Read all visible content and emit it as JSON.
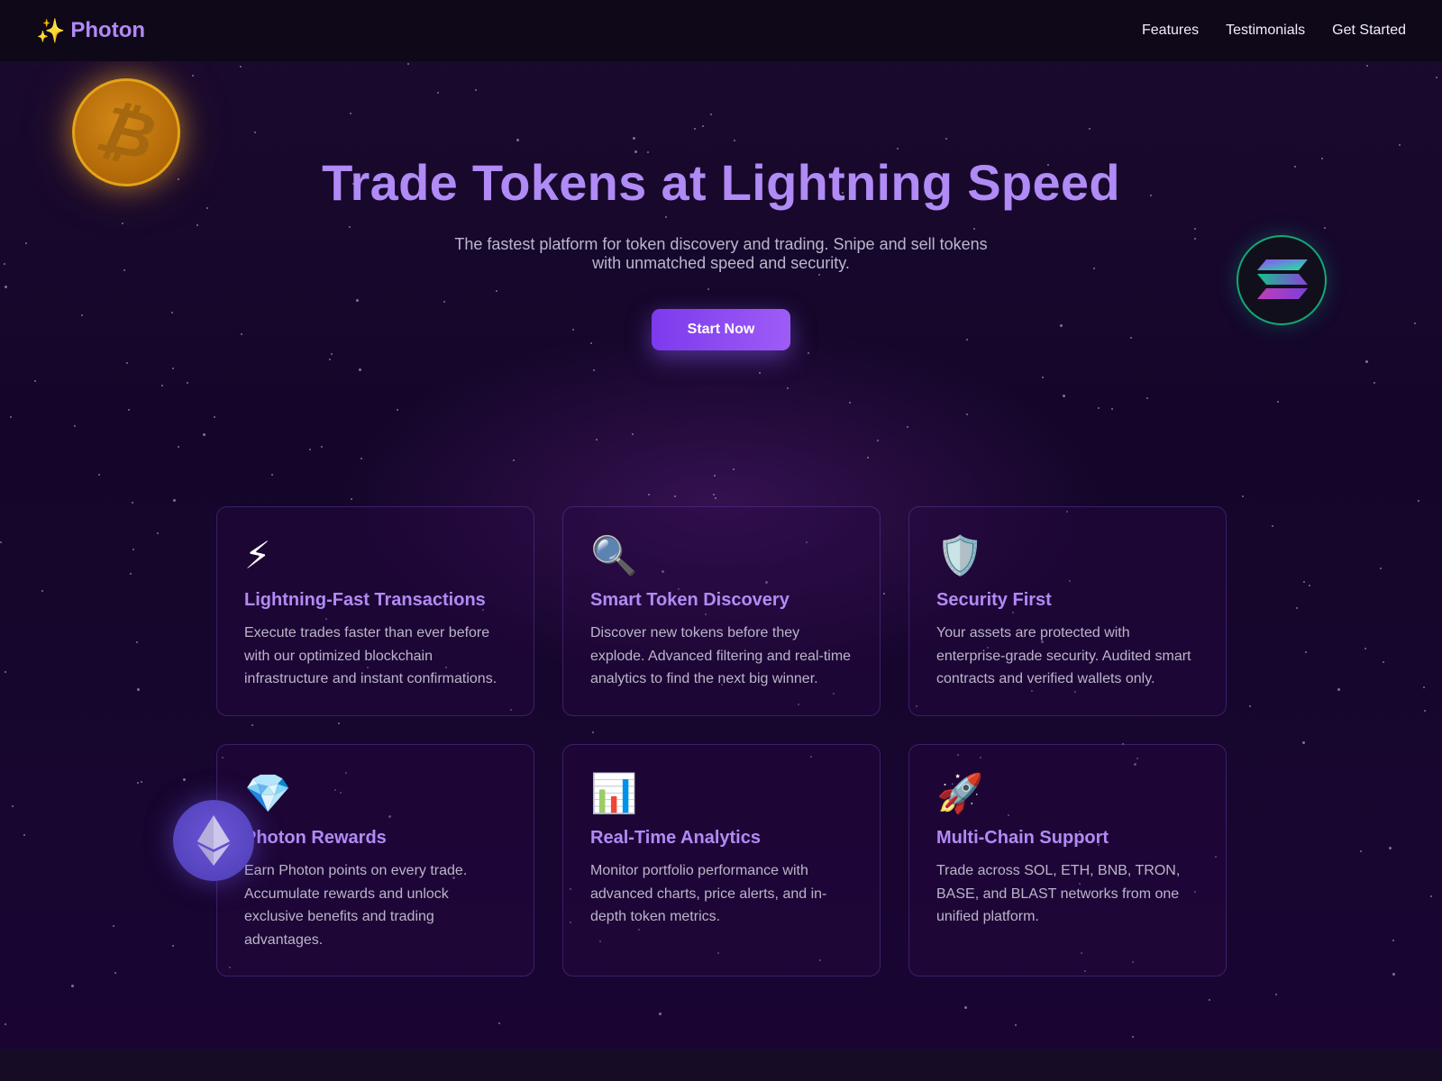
{
  "nav": {
    "logo_icon": "✨",
    "logo_text": "Photon",
    "links": [
      "Features",
      "Testimonials",
      "Get Started"
    ]
  },
  "hero": {
    "title": "Trade Tokens at Lightning Speed",
    "subtitle": "The fastest platform for token discovery and trading. Snipe and sell tokens with unmatched speed and security.",
    "cta_label": "Start Now"
  },
  "coins": {
    "btc_glyph": "₿",
    "btc_icon": "bitcoin-icon",
    "sol_icon": "solana-icon",
    "eth_icon": "ethereum-icon"
  },
  "features": [
    {
      "icon": "⚡",
      "icon_name": "lightning-icon",
      "title": "Lightning-Fast Transactions",
      "desc": "Execute trades faster than ever before with our optimized blockchain infrastructure and instant confirmations."
    },
    {
      "icon": "🔍",
      "icon_name": "magnifier-icon",
      "title": "Smart Token Discovery",
      "desc": "Discover new tokens before they explode. Advanced filtering and real-time analytics to find the next big winner."
    },
    {
      "icon": "🛡️",
      "icon_name": "shield-icon",
      "title": "Security First",
      "desc": "Your assets are protected with enterprise-grade security. Audited smart contracts and verified wallets only."
    },
    {
      "icon": "💎",
      "icon_name": "gem-icon",
      "title": "Photon Rewards",
      "desc": "Earn Photon points on every trade. Accumulate rewards and unlock exclusive benefits and trading advantages."
    },
    {
      "icon": "📊",
      "icon_name": "bar-chart-icon",
      "title": "Real-Time Analytics",
      "desc": "Monitor portfolio performance with advanced charts, price alerts, and in-depth token metrics."
    },
    {
      "icon": "🚀",
      "icon_name": "rocket-icon",
      "title": "Multi-Chain Support",
      "desc": "Trade across SOL, ETH, BNB, TRON, BASE, and BLAST networks from one unified platform."
    }
  ],
  "colors": {
    "accent": "#b08af5",
    "button": "#8b5cf6",
    "background": "#14062a",
    "btc": "#f5a623",
    "sol_border": "#14a874",
    "eth": "#5b45c8"
  }
}
